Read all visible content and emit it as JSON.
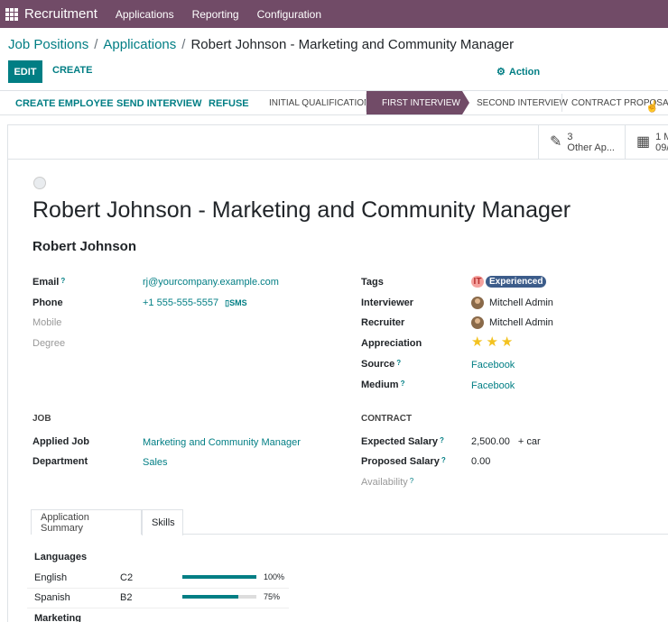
{
  "navbar": {
    "app_name": "Recruitment",
    "menus": [
      "Applications",
      "Reporting",
      "Configuration"
    ]
  },
  "breadcrumb": {
    "items": [
      "Job Positions",
      "Applications"
    ],
    "current": "Robert Johnson - Marketing and Community Manager",
    "separator": "/"
  },
  "controls": {
    "edit_label": "EDIT",
    "create_label": "CREATE",
    "action_label": "Action"
  },
  "statusbar": {
    "buttons": [
      "CREATE EMPLOYEE",
      "SEND INTERVIEW",
      "REFUSE"
    ],
    "stages": [
      "INITIAL QUALIFICATION",
      "FIRST INTERVIEW",
      "SECOND INTERVIEW",
      "CONTRACT PROPOSAL"
    ],
    "active_stage": "FIRST INTERVIEW"
  },
  "smart_buttons": [
    {
      "icon": "pencil-icon",
      "value": "3",
      "label": "Other Ap..."
    },
    {
      "icon": "calendar-icon",
      "value": "1 M",
      "label": "09/"
    }
  ],
  "record": {
    "title": "Robert Johnson - Marketing and Community Manager",
    "partner_name": "Robert Johnson"
  },
  "contact": {
    "email_label": "Email",
    "email": "rj@yourcompany.example.com",
    "phone_label": "Phone",
    "phone": "+1 555-555-5557",
    "sms_label": "SMS",
    "mobile_label": "Mobile",
    "degree_label": "Degree"
  },
  "details": {
    "tags_label": "Tags",
    "tags": [
      "IT",
      "Experienced"
    ],
    "interviewer_label": "Interviewer",
    "interviewer": "Mitchell Admin",
    "recruiter_label": "Recruiter",
    "recruiter": "Mitchell Admin",
    "appreciation_label": "Appreciation",
    "appreciation_stars": 3,
    "source_label": "Source",
    "source": "Facebook",
    "medium_label": "Medium",
    "medium": "Facebook"
  },
  "job": {
    "section": "JOB",
    "applied_job_label": "Applied Job",
    "applied_job": "Marketing and Community Manager",
    "department_label": "Department",
    "department": "Sales"
  },
  "contract": {
    "section": "CONTRACT",
    "expected_salary_label": "Expected Salary",
    "expected_salary": "2,500.00",
    "expected_extra": "+  car",
    "proposed_salary_label": "Proposed Salary",
    "proposed_salary": "0.00",
    "availability_label": "Availability"
  },
  "tabs": [
    "Application Summary",
    "Skills"
  ],
  "active_tab": "Skills",
  "skills": {
    "group": "Languages",
    "rows": [
      {
        "name": "English",
        "level": "C2",
        "progress": 100,
        "pct": "100%"
      },
      {
        "name": "Spanish",
        "level": "B2",
        "progress": 75,
        "pct": "75%"
      }
    ],
    "next_group": "Marketing"
  },
  "help_mark": "?"
}
